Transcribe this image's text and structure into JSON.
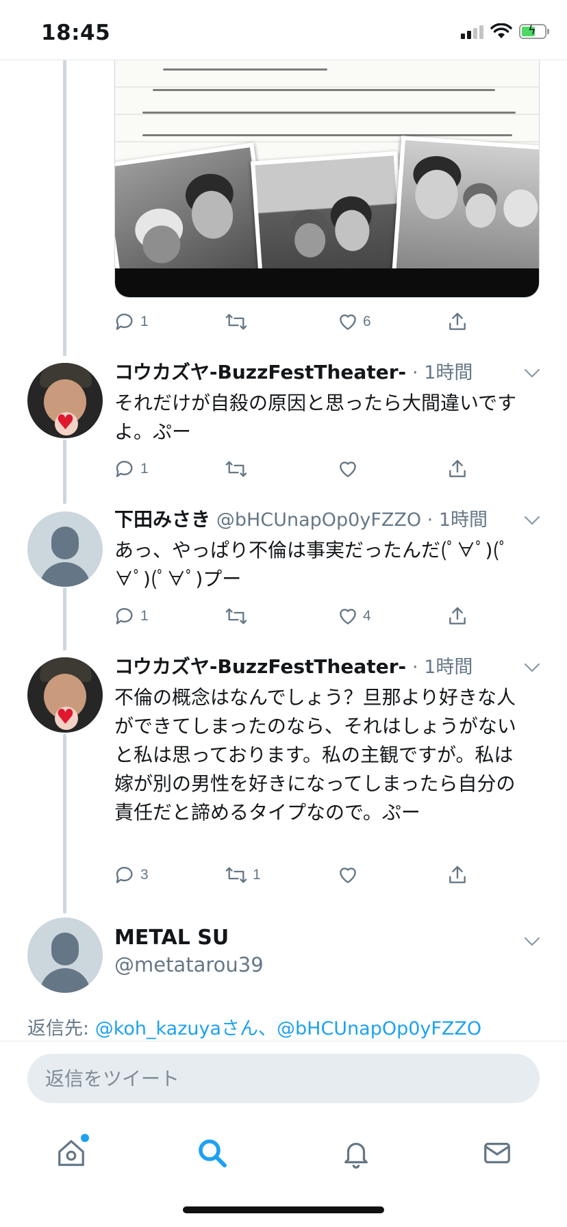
{
  "status_bar": {
    "time": "18:45",
    "icons": [
      "cellular-signal-icon",
      "wifi-icon",
      "battery-charging-icon"
    ],
    "battery_color": "#4cd964"
  },
  "colors": {
    "accent": "#1da1f2",
    "secondary_text": "#657786",
    "thread_line": "#ccd6dd"
  },
  "media_tweet": {
    "actions": {
      "reply_count": "1",
      "retweet_count": "",
      "like_count": "6"
    }
  },
  "tweets": [
    {
      "name": "コウカズヤ-BuzzFestTheater-",
      "meta": "· 1時間",
      "text": "それだけが自殺の原因と思ったら大間違いですよ。ぷー",
      "avatar": "user-photo",
      "actions": {
        "reply_count": "1",
        "retweet_count": "",
        "like_count": ""
      }
    },
    {
      "name": "下田みさき",
      "meta": "@bHCUnapOp0yFZZO · 1時間",
      "text": "あっ、やっぱり不倫は事実だったんだ(ﾟ∀ﾟ)(ﾟ∀ﾟ)(ﾟ∀ﾟ)プー",
      "avatar": "default-profile",
      "actions": {
        "reply_count": "1",
        "retweet_count": "",
        "like_count": "4"
      }
    },
    {
      "name": "コウカズヤ-BuzzFestTheater-",
      "meta": "· 1時間",
      "text": "不倫の概念はなんでしょう？旦那より好きな人ができてしまったのなら、それはしょうがないと私は思っております。私の主観ですが。私は嫁が別の男性を好きになってしまったら自分の責任だと諦めるタイプなので。ぷー",
      "avatar": "user-photo",
      "actions": {
        "reply_count": "3",
        "retweet_count": "1",
        "like_count": ""
      }
    }
  ],
  "composer": {
    "name": "METAL SU",
    "handle": "@metatarou39",
    "reply_to_prefix": "返信先: ",
    "reply_to_users": "@koh_kazuyaさん、@bHCUnapOp0yFZZO",
    "placeholder": "返信をツイート"
  },
  "tab_bar": {
    "tabs": [
      "home-icon",
      "search-icon",
      "notifications-bell-icon",
      "messages-envelope-icon"
    ],
    "active": "search-icon"
  }
}
